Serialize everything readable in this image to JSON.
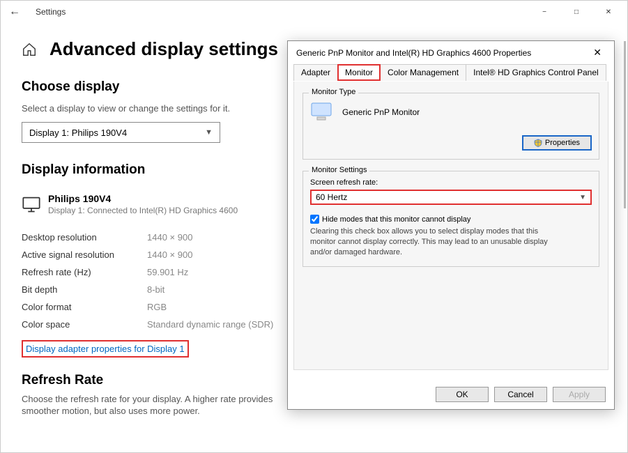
{
  "window": {
    "title": "Settings",
    "page_title": "Advanced display settings"
  },
  "choose": {
    "heading": "Choose display",
    "sub": "Select a display to view or change the settings for it.",
    "selected": "Display 1: Philips 190V4"
  },
  "info": {
    "heading": "Display information",
    "monitor_name": "Philips 190V4",
    "monitor_sub": "Display 1: Connected to Intel(R) HD Graphics 4600",
    "rows": {
      "desktop_res_k": "Desktop resolution",
      "desktop_res_v": "1440 × 900",
      "active_res_k": "Active signal resolution",
      "active_res_v": "1440 × 900",
      "refresh_k": "Refresh rate (Hz)",
      "refresh_v": "59.901 Hz",
      "bit_k": "Bit depth",
      "bit_v": "8-bit",
      "fmt_k": "Color format",
      "fmt_v": "RGB",
      "space_k": "Color space",
      "space_v": "Standard dynamic range (SDR)"
    },
    "link": "Display adapter properties for Display 1"
  },
  "rr": {
    "heading": "Refresh Rate",
    "sub": "Choose the refresh rate for your display. A higher rate provides smoother motion, but also uses more power."
  },
  "dialog": {
    "title": "Generic PnP Monitor and Intel(R) HD Graphics 4600 Properties",
    "tabs": {
      "adapter": "Adapter",
      "monitor": "Monitor",
      "color": "Color Management",
      "intel": "Intel® HD Graphics Control Panel"
    },
    "monitor_type": "Monitor Type",
    "monitor_name": "Generic PnP Monitor",
    "props_btn": "Properties",
    "monitor_settings": "Monitor Settings",
    "refresh_label": "Screen refresh rate:",
    "refresh_value": "60 Hertz",
    "hide_label": "Hide modes that this monitor cannot display",
    "clear_text": "Clearing this check box allows you to select display modes that this monitor cannot display correctly. This may lead to an unusable display and/or damaged hardware.",
    "buttons": {
      "ok": "OK",
      "cancel": "Cancel",
      "apply": "Apply"
    }
  }
}
